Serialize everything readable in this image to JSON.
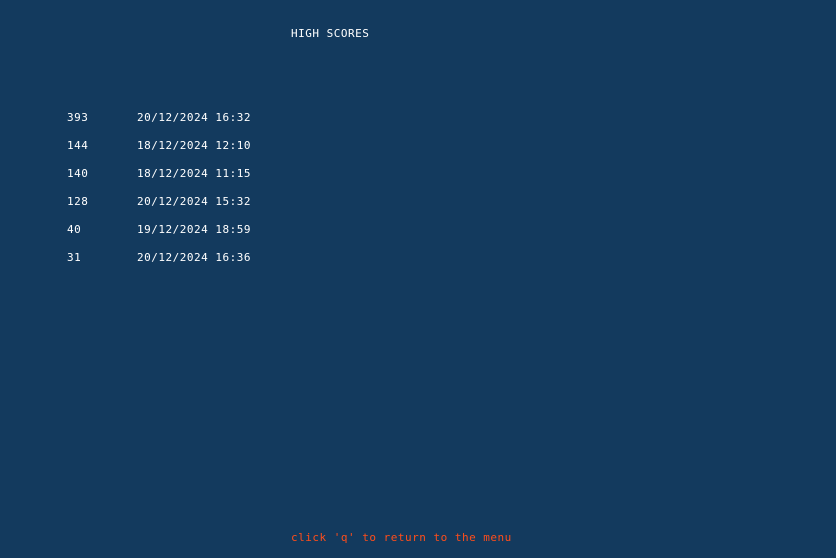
{
  "title": "HIGH SCORES",
  "scores": [
    {
      "score": "393",
      "datetime": "20/12/2024 16:32"
    },
    {
      "score": "144",
      "datetime": "18/12/2024 12:10"
    },
    {
      "score": "140",
      "datetime": "18/12/2024 11:15"
    },
    {
      "score": "128",
      "datetime": "20/12/2024 15:32"
    },
    {
      "score": "40",
      "datetime": "19/12/2024 18:59"
    },
    {
      "score": "31",
      "datetime": "20/12/2024 16:36"
    }
  ],
  "hint": "click 'q' to return to the menu",
  "colors": {
    "background": "#133a5e",
    "text": "#ffffff",
    "hint": "#ff4d1a"
  }
}
